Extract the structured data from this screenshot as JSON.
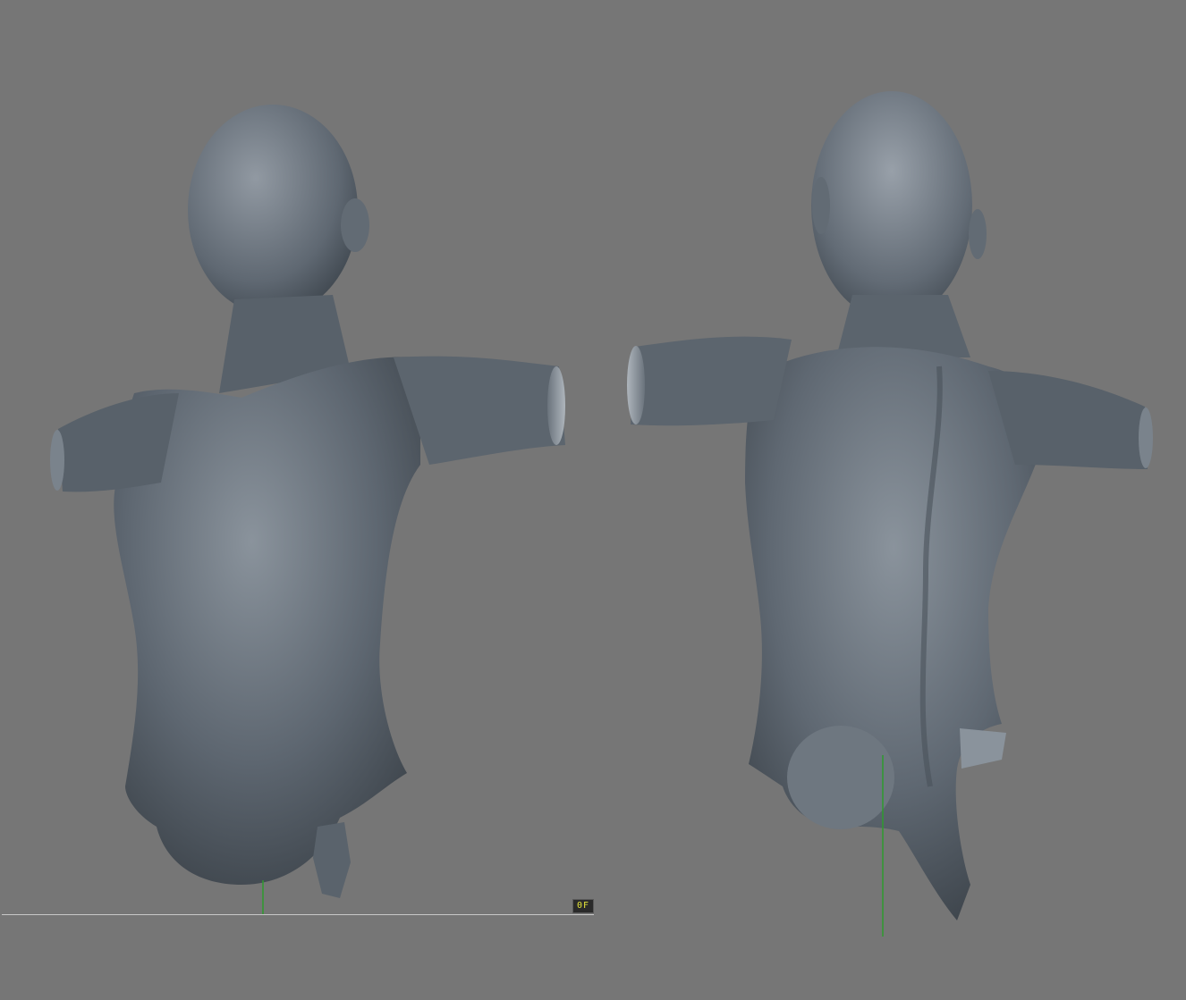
{
  "viewport": {
    "background_color": "#767676",
    "model_color": "#5d6670",
    "axis_color": "#2f9a2f",
    "ground_line_color": "#c8c8c8"
  },
  "views": [
    {
      "id": "front",
      "description_icon": "sculpt-mesh-icon"
    },
    {
      "id": "back",
      "description_icon": "sculpt-mesh-icon"
    }
  ],
  "hud": {
    "frame_badge_label": "0F",
    "frame_badge_text_color": "#e6e63a"
  }
}
